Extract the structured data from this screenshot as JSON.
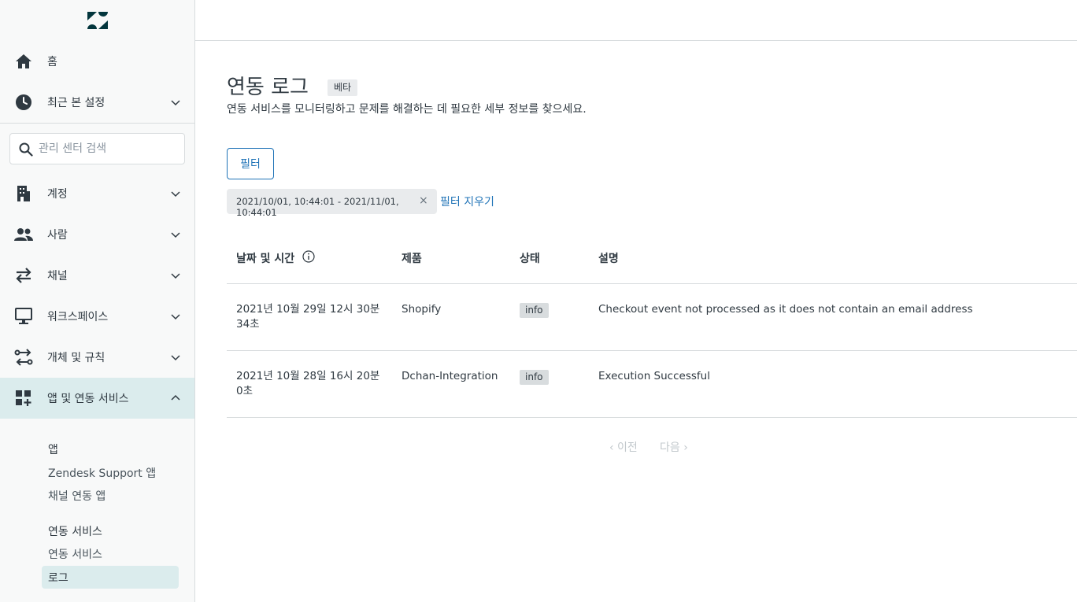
{
  "sidebar": {
    "nav": [
      {
        "label": "홈",
        "icon": "home-icon"
      },
      {
        "label": "최근 본 설정",
        "icon": "clock-icon"
      },
      {
        "label": "계정",
        "icon": "building-icon"
      },
      {
        "label": "사람",
        "icon": "people-icon"
      },
      {
        "label": "채널",
        "icon": "arrows-swap-icon"
      },
      {
        "label": "워크스페이스",
        "icon": "monitor-icon"
      },
      {
        "label": "개체 및 규칙",
        "icon": "flow-icon"
      },
      {
        "label": "앱 및 연동 서비스",
        "icon": "apps-plus-icon"
      }
    ],
    "search_placeholder": "관리 센터 검색",
    "sub_sections": {
      "apps_head": "앱",
      "zendesk_support_apps": "Zendesk Support 앱",
      "channel_apps": "채널 연동 앱",
      "integrations_head": "연동 서비스",
      "integrations": "연동 서비스",
      "logs": "로그"
    }
  },
  "main": {
    "title": "연동 로그",
    "beta": "베타",
    "description": "연동 서비스를 모니터링하고 문제를 해결하는 데 필요한 세부 정보를 찾으세요.",
    "filter_button": "필터",
    "filter_tag": "2021/10/01, 10:44:01 - 2021/11/01, 10:44:01",
    "filter_tag_close": "×",
    "clear_filters": "필터 지우기",
    "table": {
      "headers": [
        "날짜 및 시간",
        "제품",
        "상태",
        "설명"
      ],
      "rows": [
        {
          "datetime_line1": "2021년 10월 29일 12시 30분",
          "datetime_line2": "34초",
          "product": "Shopify",
          "status": "info",
          "description": "Checkout event not processed as it does not contain an email address"
        },
        {
          "datetime_line1": "2021년 10월 28일 16시 20분",
          "datetime_line2": "0초",
          "product": "Dchan-Integration",
          "status": "info",
          "description": "Execution Successful"
        }
      ]
    },
    "pager": {
      "prev": "‹ 이전",
      "next": "다음 ›"
    }
  },
  "colors": {
    "accent": "#1f73b7",
    "active_bg": "#dbeced",
    "text": "#2f3941"
  }
}
